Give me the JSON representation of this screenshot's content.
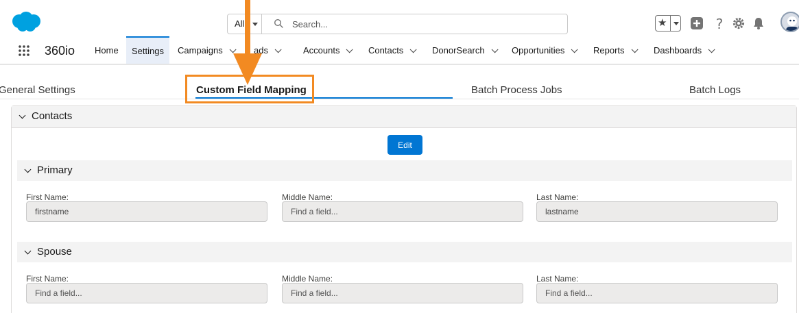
{
  "header": {
    "search_scope": "All",
    "search_placeholder": "Search..."
  },
  "nav": {
    "app_name": "360io",
    "items": [
      {
        "label": "Home"
      },
      {
        "label": "Settings"
      },
      {
        "label": "Campaigns"
      },
      {
        "label": "ads"
      },
      {
        "label": "Accounts"
      },
      {
        "label": "Contacts"
      },
      {
        "label": "DonorSearch"
      },
      {
        "label": "Opportunities"
      },
      {
        "label": "Reports"
      },
      {
        "label": "Dashboards"
      }
    ],
    "active": "Settings"
  },
  "tabs": [
    {
      "label": "General Settings"
    },
    {
      "label": "Custom Field Mapping"
    },
    {
      "label": "Batch Process Jobs"
    },
    {
      "label": "Batch Logs"
    }
  ],
  "card": {
    "title": "Contacts",
    "edit_label": "Edit",
    "sections": [
      {
        "title": "Primary",
        "fields": [
          {
            "label": "First Name:",
            "value": "firstname",
            "placeholder": "Find a field..."
          },
          {
            "label": "Middle Name:",
            "value": "",
            "placeholder": "Find a field..."
          },
          {
            "label": "Last Name:",
            "value": "lastname",
            "placeholder": "Find a field..."
          }
        ]
      },
      {
        "title": "Spouse",
        "fields": [
          {
            "label": "First Name:",
            "value": "",
            "placeholder": "Find a field..."
          },
          {
            "label": "Middle Name:",
            "value": "",
            "placeholder": "Find a field..."
          },
          {
            "label": "Last Name:",
            "value": "",
            "placeholder": "Find a field..."
          }
        ]
      }
    ]
  },
  "colors": {
    "brand_blue": "#0176d3",
    "annotation_orange": "#f28a22",
    "logo_blue": "#00a1e0"
  },
  "icons": [
    "salesforce-cloud-icon",
    "search-icon",
    "star-icon",
    "add-icon",
    "help-icon",
    "setup-gear-icon",
    "bell-icon",
    "app-launcher-icon",
    "chevron-down-icon"
  ]
}
